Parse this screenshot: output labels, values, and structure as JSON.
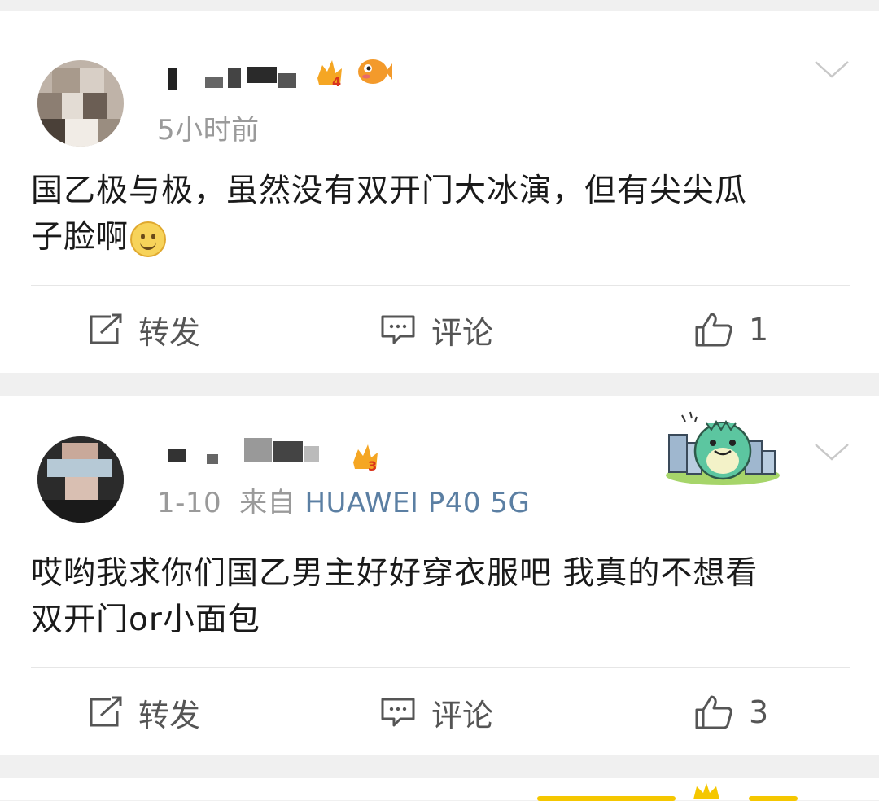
{
  "posts": [
    {
      "time": "5小时前",
      "source_prefix": "",
      "device": "",
      "badge_level": "4",
      "text_line1": "国乙极与极，虽然没有双开门大冰演，但有尖尖瓜",
      "text_line2": "子脸啊",
      "actions": {
        "repost": "转发",
        "comment": "评论",
        "like": "1"
      }
    },
    {
      "time": "1-10",
      "source_prefix": "来自",
      "device": "HUAWEI P40 5G",
      "badge_level": "3",
      "text_line1": "哎哟我求你们国乙男主好好穿衣服吧 我真的不想看",
      "text_line2": "双开门or小面包",
      "actions": {
        "repost": "转发",
        "comment": "评论",
        "like": "3"
      }
    }
  ],
  "icons": {
    "repost": "repost-icon",
    "comment": "comment-icon",
    "like": "thumbs-up-icon",
    "more": "chevron-down-icon",
    "emoji": "smile-emoji-icon",
    "badge_fan": "fan-badge-icon",
    "badge_fish": "fish-badge-icon",
    "sticker": "green-dinosaur-sticker"
  },
  "colors": {
    "background": "#f0f0f0",
    "card": "#ffffff",
    "text": "#1a1a1a",
    "meta": "#9a9a9a",
    "device": "#5b7fa3",
    "badge": "#f5a623"
  }
}
